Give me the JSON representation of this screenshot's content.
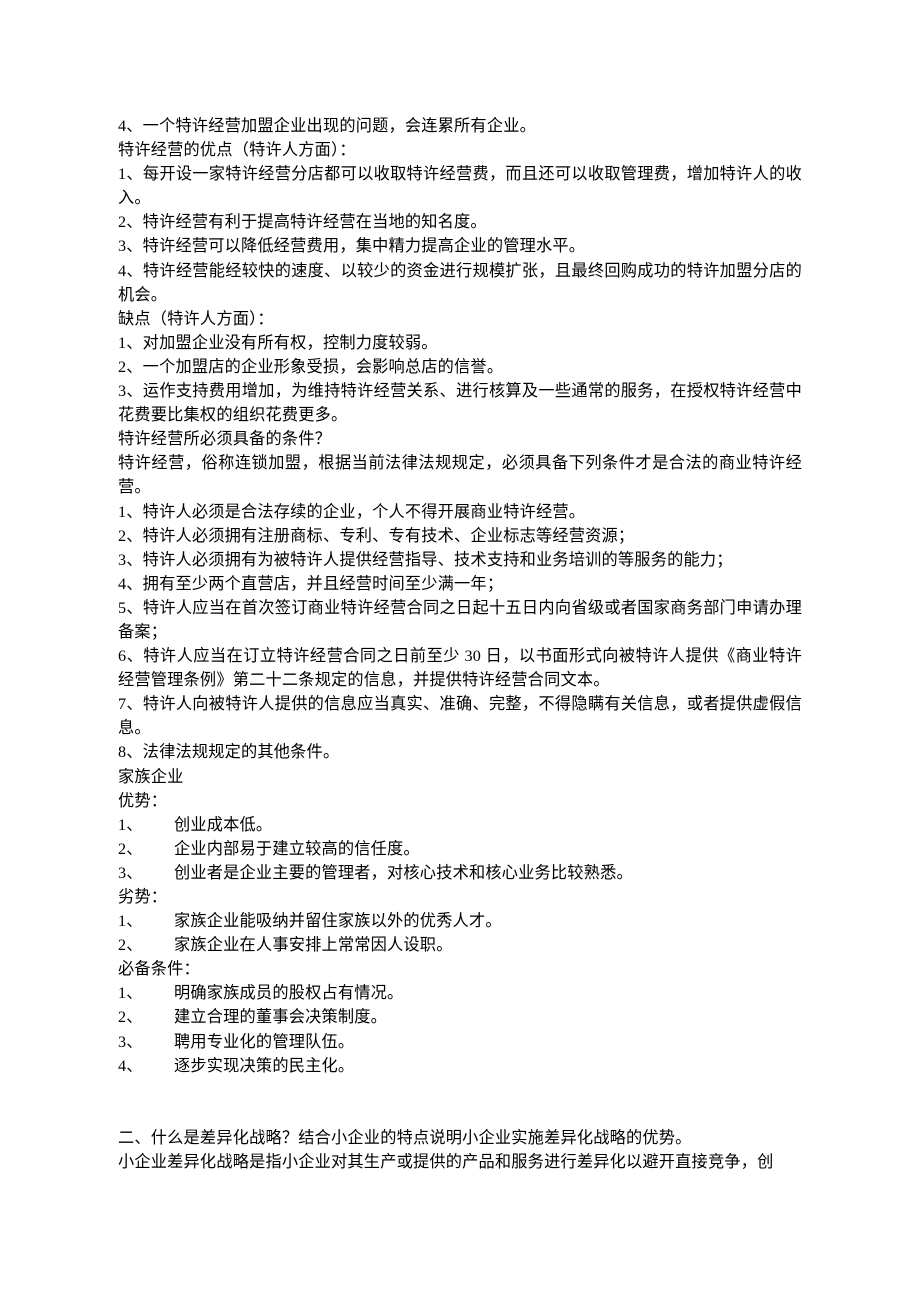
{
  "lines": [
    "4、一个特许经营加盟企业出现的问题，会连累所有企业。",
    "特许经营的优点（特许人方面）：",
    "1、每开设一家特许经营分店都可以收取特许经营费，而且还可以收取管理费，增加特许人的收入。",
    "2、特许经营有利于提高特许经营在当地的知名度。",
    "3、特许经营可以降低经营费用，集中精力提高企业的管理水平。",
    "4、特许经营能经较快的速度、以较少的资金进行规模扩张，且最终回购成功的特许加盟分店的机会。",
    "缺点（特许人方面）：",
    "1、对加盟企业没有所有权，控制力度较弱。",
    "2、一个加盟店的企业形象受损，会影响总店的信誉。",
    "3、运作支持费用增加，为维持特许经营关系、进行核算及一些通常的服务，在授权特许经营中花费要比集权的组织花费更多。",
    "特许经营所必须具备的条件？",
    "特许经营，俗称连锁加盟，根据当前法律法规规定，必须具备下列条件才是合法的商业特许经营。",
    "1、特许人必须是合法存续的企业，个人不得开展商业特许经营。",
    "2、特许人必须拥有注册商标、专利、专有技术、企业标志等经营资源；",
    "3、特许人必须拥有为被特许人提供经营指导、技术支持和业务培训的等服务的能力；",
    "4、拥有至少两个直营店，并且经营时间至少满一年；",
    "5、特许人应当在首次签订商业特许经营合同之日起十五日内向省级或者国家商务部门申请办理备案；",
    "6、特许人应当在订立特许经营合同之日前至少 30 日，以书面形式向被特许人提供《商业特许经营管理条例》第二十二条规定的信息，并提供特许经营合同文本。",
    "7、特许人向被特许人提供的信息应当真实、准确、完整，不得隐瞒有关信息，或者提供虚假信息。",
    "8、法律法规规定的其他条件。",
    "家族企业",
    "优势："
  ],
  "advList": [
    {
      "n": "1、",
      "t": "创业成本低。"
    },
    {
      "n": "2、",
      "t": "企业内部易于建立较高的信任度。"
    },
    {
      "n": "3、",
      "t": "创业者是企业主要的管理者，对核心技术和核心业务比较熟悉。"
    }
  ],
  "disHeading": "劣势：",
  "disList": [
    {
      "n": "1、",
      "t": "家族企业能吸纳并留住家族以外的优秀人才。"
    },
    {
      "n": "2、",
      "t": "家族企业在人事安排上常常因人设职。"
    }
  ],
  "condHeading": "必备条件：",
  "condList": [
    {
      "n": "1、",
      "t": "明确家族成员的股权占有情况。"
    },
    {
      "n": "2、",
      "t": "建立合理的董事会决策制度。"
    },
    {
      "n": "3、",
      "t": "聘用专业化的管理队伍。"
    },
    {
      "n": "4、",
      "t": "逐步实现决策的民主化。"
    }
  ],
  "tail": [
    "二、什么是差异化战略？结合小企业的特点说明小企业实施差异化战略的优势。",
    "小企业差异化战略是指小企业对其生产或提供的产品和服务进行差异化以避开直接竞争，创"
  ]
}
